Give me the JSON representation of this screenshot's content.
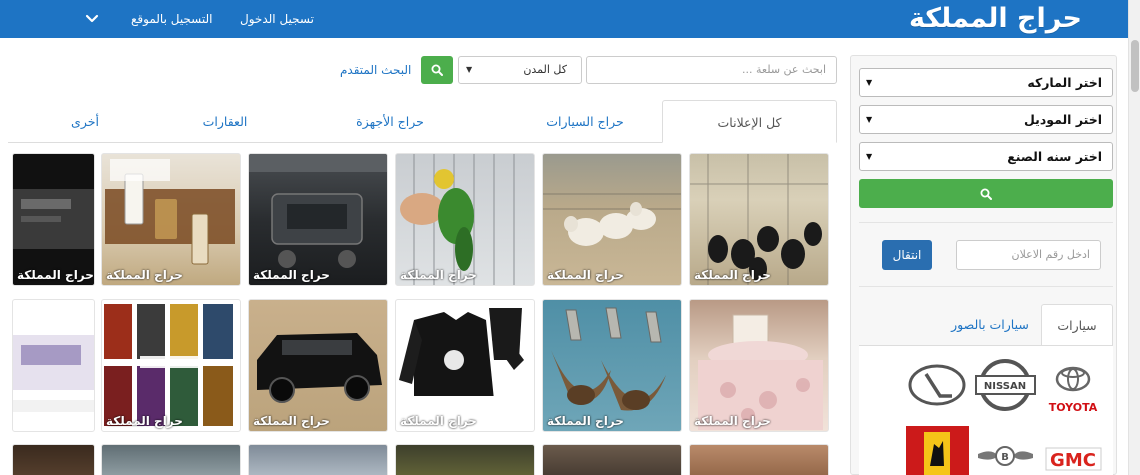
{
  "header": {
    "logo": "حراج المملكة",
    "login": "تسجيل الدخول",
    "register": "التسجيل بالموقع"
  },
  "search": {
    "placeholder": "ابحث عن سلعة ...",
    "city": "كل المدن",
    "advanced": "البحث المتقدم"
  },
  "tabs": [
    {
      "label": "كل الإعلانات",
      "active": true
    },
    {
      "label": "حراج السيارات"
    },
    {
      "label": "حراج الأجهزة"
    },
    {
      "label": "العقارات"
    },
    {
      "label": "أخرى"
    }
  ],
  "watermark": "حراج المملكة",
  "sidebar": {
    "brand_select": "اختر الماركه",
    "model_select": "اختر الموديل",
    "year_select": "اختر سنه الصنع",
    "ad_number_placeholder": "ادخل رقم الاعلان",
    "go_button": "انتقال",
    "tab_cars": "سيارات",
    "tab_cars_photos": "سيارات بالصور",
    "brands": [
      {
        "name": "TOYOTA",
        "icon": "toyota-logo"
      },
      {
        "name": "NISSAN",
        "icon": "nissan-logo"
      },
      {
        "name": "LEXUS",
        "icon": "lexus-logo"
      },
      {
        "name": "GMC",
        "icon": "gmc-logo"
      },
      {
        "name": "BENTLEY",
        "icon": "bentley-logo"
      },
      {
        "name": "FERRARI",
        "icon": "ferrari-logo"
      }
    ]
  },
  "listings": [
    {
      "subject": "goats-in-pen-photo"
    },
    {
      "subject": "sheep-in-pen-photo"
    },
    {
      "subject": "green-parrot-photo"
    },
    {
      "subject": "car-dashboard-photo"
    },
    {
      "subject": "perfume-bottles-photo"
    },
    {
      "subject": "dark-document-photo"
    },
    {
      "subject": "bedding-set-photo"
    },
    {
      "subject": "daggers-photo"
    },
    {
      "subject": "black-tracksuit-photo"
    },
    {
      "subject": "black-suv-photo"
    },
    {
      "subject": "game-covers-photo"
    },
    {
      "subject": "phone-screenshot-photo"
    }
  ],
  "colors": {
    "header": "#1e74c4",
    "green": "#4cae4c",
    "go_button": "#2a6eb0",
    "link": "#1e74c4"
  }
}
